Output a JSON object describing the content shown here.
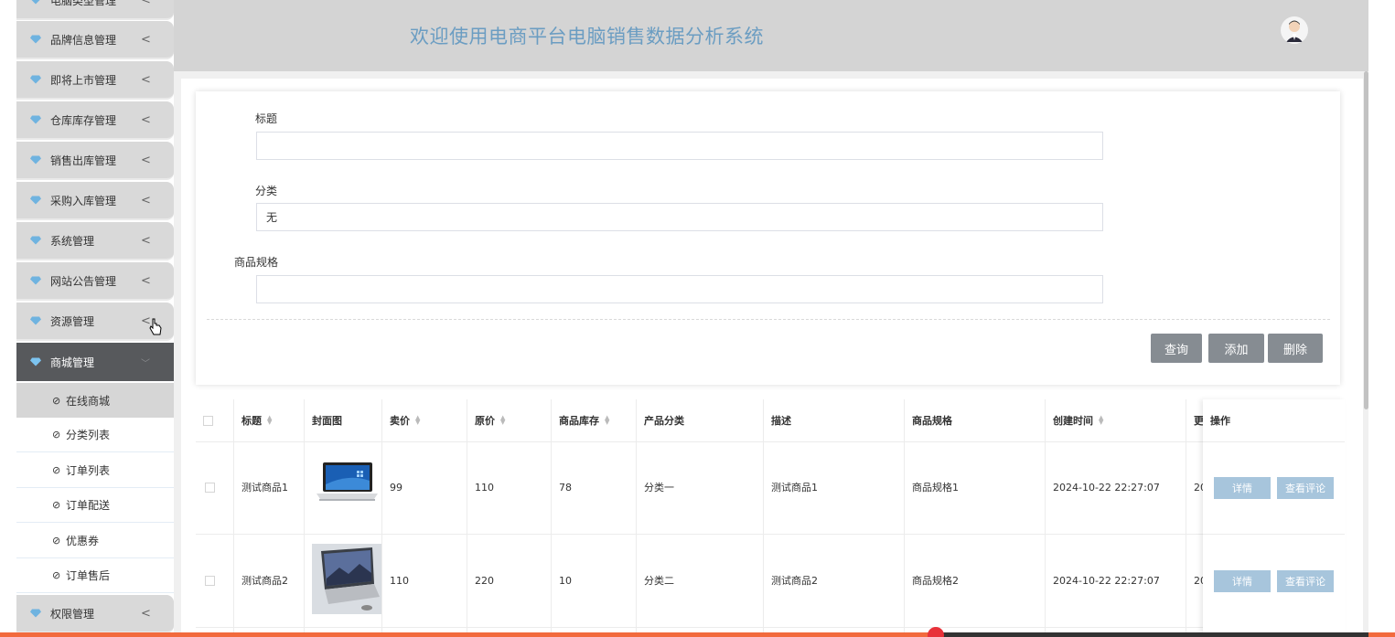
{
  "header": {
    "title": "欢迎使用电商平台电脑销售数据分析系统"
  },
  "sidebar": {
    "items": [
      {
        "label": "电脑类型管理"
      },
      {
        "label": "品牌信息管理"
      },
      {
        "label": "即将上市管理"
      },
      {
        "label": "仓库库存管理"
      },
      {
        "label": "销售出库管理"
      },
      {
        "label": "采购入库管理"
      },
      {
        "label": "系统管理"
      },
      {
        "label": "网站公告管理"
      },
      {
        "label": "资源管理"
      },
      {
        "label": "商城管理"
      },
      {
        "label": "权限管理"
      }
    ],
    "sub_items": [
      {
        "label": "在线商城"
      },
      {
        "label": "分类列表"
      },
      {
        "label": "订单列表"
      },
      {
        "label": "订单配送"
      },
      {
        "label": "优惠券"
      },
      {
        "label": "订单售后"
      }
    ]
  },
  "search": {
    "title_label": "标题",
    "title_value": "",
    "category_label": "分类",
    "category_value": "无",
    "spec_label": "商品规格",
    "spec_value": "",
    "query_button": "查询",
    "add_button": "添加",
    "delete_button": "删除"
  },
  "table": {
    "headers": [
      "标题",
      "封面图",
      "卖价",
      "原价",
      "商品库存",
      "产品分类",
      "描述",
      "商品规格",
      "创建时间",
      "更",
      "操作"
    ],
    "rows": [
      {
        "title": "测试商品1",
        "price": "99",
        "original": "110",
        "stock": "78",
        "category": "分类一",
        "desc": "测试商品1",
        "spec": "商品规格1",
        "created": "2024-10-22 22:27:07",
        "updated": "20"
      },
      {
        "title": "测试商品2",
        "price": "110",
        "original": "220",
        "stock": "10",
        "category": "分类二",
        "desc": "测试商品2",
        "spec": "商品规格2",
        "created": "2024-10-22 22:27:07",
        "updated": "20"
      }
    ],
    "detail_button": "详情",
    "comments_button": "查看评论"
  },
  "colors": {
    "accent": "#6b9dc2",
    "header_bg": "#d4d4d4",
    "active_menu": "#57595c",
    "op_button": "#a7c5dc",
    "gray_button": "#868c92"
  }
}
